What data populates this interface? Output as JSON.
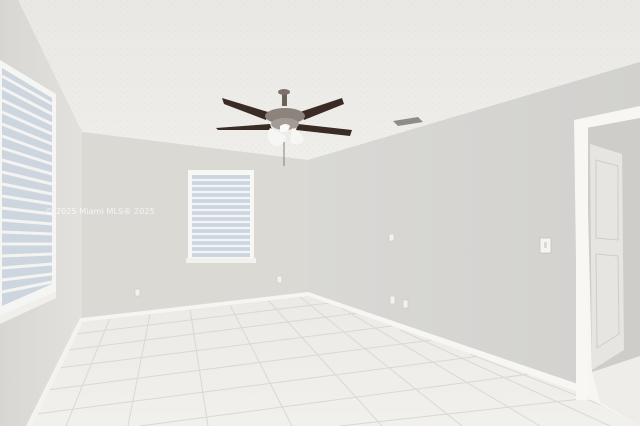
{
  "photo": {
    "watermark": "© 2025 Miami MLS® 2025",
    "scene": "empty-room-interior",
    "colors": {
      "ceiling": "#ecebe7",
      "left_wall": "#e2e0dc",
      "back_wall": "#dcdad5",
      "right_wall": "#d6d5d2",
      "floor_tile": "#efeeea",
      "grout": "#d9d7d2",
      "baseboard": "#f7f6f3",
      "window_light": "#cdd9e6",
      "fan_blade": "#3a2c24",
      "door": "#e7e6e3"
    }
  }
}
